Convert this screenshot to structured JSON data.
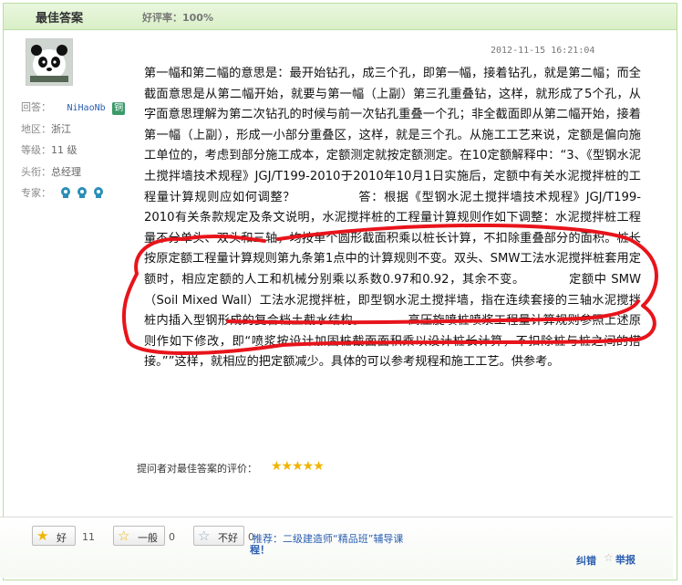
{
  "header": {
    "title": "最佳答案",
    "rating": "好评率：100%"
  },
  "user": {
    "answerer_label": "回答：",
    "name": "NiHaoNb",
    "grade_badge": "铜",
    "region_label": "地区：",
    "region": "浙江",
    "level_label": "等级：",
    "level": "11 级",
    "rank_label": "头衔：",
    "rank": "总经理",
    "expert_label": "专家："
  },
  "timestamp": "2012-11-15 16:21:04",
  "answer": {
    "p1": "第一幅和第二幅的意思是：最开始钻孔，成三个孔，即第一幅，接着钻孔，就是第二幅；而全截面意思是从第二幅开始，就要与第一幅（上副）第三孔重叠钻，这样，就形成了5个孔，从字面意思理解为第二次钻孔的时候与前一次钻孔重叠一个孔；非全截面即从第二幅开始，接着第一幅（上副），形成一小部分重叠区，这样，就是三个孔。从施工工艺来说，定额是偏向施工单位的，考虑到部分施工成本，定额测定就按定额测定。在10定额解释中：“3、《型钢水泥土搅拌墙技术规程》JGJ/T199-2010于2010年10月1日实施后，定额中有关水泥搅拌桩的工程量计算规则应如何调整？",
    "p2": "答：根据《型钢水泥土搅拌墙技术规程》JGJ/T199-2010有关条款规定及条文说明，水泥搅拌桩的工程量计算规则作如下调整：水泥搅拌桩工程量不分单头、双头和三轴，均按单个圆形截面积乘以桩长计算，不扣除重叠部分的面积。桩长按原定额工程量计算规则第九条第1点中的计算规则不变。双头、SMW工法水泥搅拌桩套用定额时，相应定额的人工和机械分别乘以系数0.97和0.92，其余不变。",
    "p3": "定额中 SMW（Soil Mixed Wall）工法水泥搅拌桩，即型钢水泥土搅拌墙，指在连续套接的三轴水泥搅拌桩内插入型钢形成的复合档土截水结构。",
    "p4": "高压旋喷桩喷浆工程量计算规则参照上述原则作如下修改，即“喷浆按设计加固桩截面面积乘以设计桩长计算，不扣除桩与桩之间的搭接。”",
    "p5": "”这样，就相应的把定额减少。具体的可以参考规程和施工工艺。供参考。"
  },
  "evaluation_label": "提问者对最佳答案的评价：",
  "stars": "★★★★★",
  "votes": [
    {
      "label": "好",
      "count": "11"
    },
    {
      "label": "一般",
      "count": "0"
    },
    {
      "label": "不好",
      "count": "0"
    }
  ],
  "promo": {
    "prefix": "推荐：",
    "link": "二级建造师“精品班”辅导课",
    "wrap": "程！"
  },
  "actions": {
    "correct": "纠错",
    "report": "举报"
  },
  "colors": {
    "link": "#2a5db0",
    "header_bg": "#d9efc7",
    "border": "#b9dda0",
    "annotation": "#e8141b",
    "star": "#f0b400"
  }
}
